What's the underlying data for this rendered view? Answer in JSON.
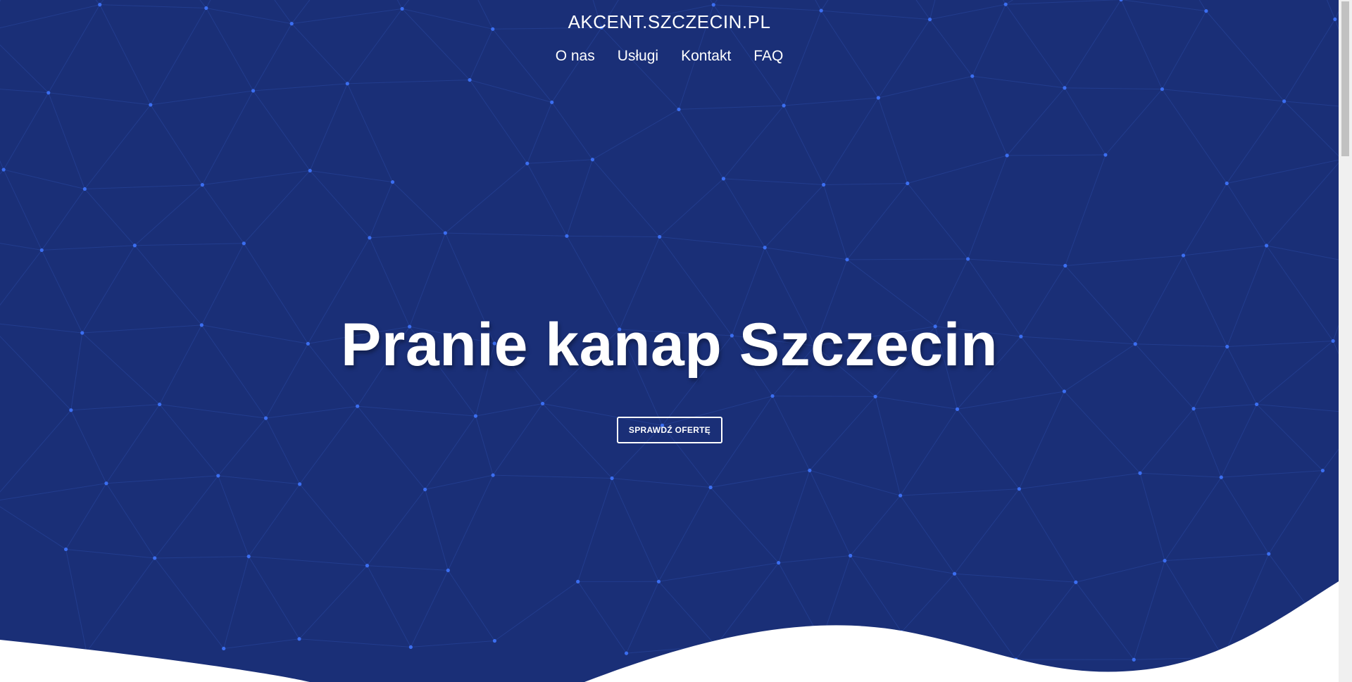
{
  "site": {
    "title": "AKCENT.SZCZECIN.PL"
  },
  "nav": {
    "items": [
      {
        "label": "O nas"
      },
      {
        "label": "Usługi"
      },
      {
        "label": "Kontakt"
      },
      {
        "label": "FAQ"
      }
    ]
  },
  "hero": {
    "headline": "Pranie kanap Szczecin",
    "cta_label": "SPRAWDŹ OFERTĘ"
  },
  "colors": {
    "hero_background": "#1a2f77",
    "network_dot": "#3b6ef0",
    "network_line": "#2a48a0",
    "wave": "#ffffff",
    "text": "#ffffff"
  },
  "icons": {
    "background": "particle-network"
  }
}
